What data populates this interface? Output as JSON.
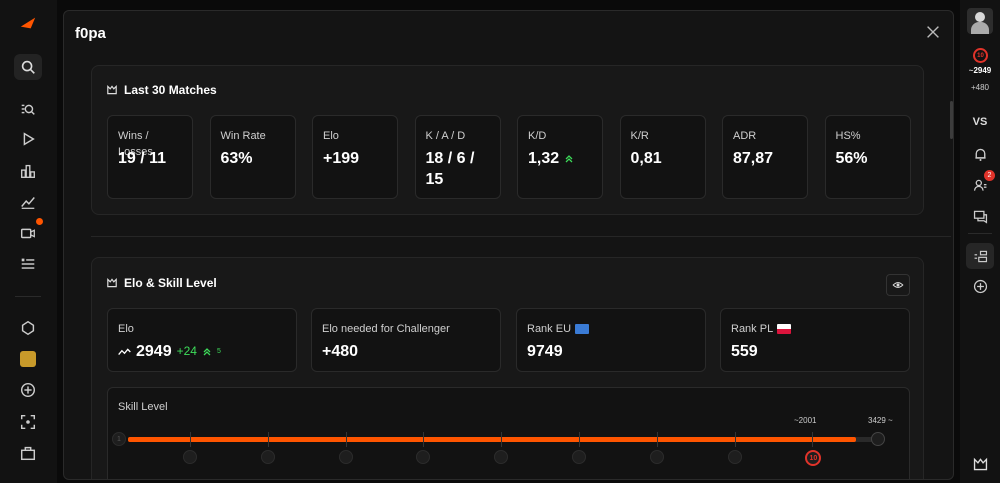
{
  "modal": {
    "title": "f0pa"
  },
  "last_matches": {
    "title": "Last 30 Matches",
    "stats": [
      {
        "label": "Wins / Losses",
        "value": "19 / 11"
      },
      {
        "label": "Win Rate",
        "value": "63%"
      },
      {
        "label": "Elo",
        "value": "+199"
      },
      {
        "label": "K / A / D",
        "value": "18 / 6 / 15"
      },
      {
        "label": "K/D",
        "value": "1,32"
      },
      {
        "label": "K/R",
        "value": "0,81"
      },
      {
        "label": "ADR",
        "value": "87,87"
      },
      {
        "label": "HS%",
        "value": "56%"
      }
    ]
  },
  "elo_section": {
    "title": "Elo & Skill Level",
    "elo_label": "Elo",
    "elo_value": "2949",
    "elo_change": "+24",
    "elo_streak": "5",
    "challenger_label": "Elo needed for Challenger",
    "challenger_value": "+480",
    "rank_eu_label": "Rank EU",
    "rank_eu_value": "9749",
    "rank_pl_label": "Rank PL",
    "rank_pl_value": "559"
  },
  "skill": {
    "label": "Skill Level",
    "current_marker": "2001",
    "max_marker": "3429",
    "start_level": "1",
    "current_level": "10",
    "progress": 0.97
  },
  "right_sidebar": {
    "elo": "2949",
    "needed": "+480",
    "vs": "VS",
    "level": "10",
    "friends_badge": "2"
  },
  "colors": {
    "accent": "#ff5500",
    "positive": "#3ddc5a",
    "card_bg": "#121212"
  }
}
